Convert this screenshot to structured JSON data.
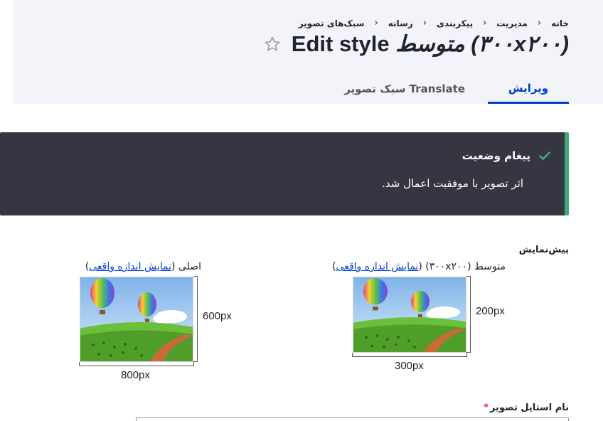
{
  "breadcrumb": {
    "items": [
      "خانه",
      "مدیریت",
      "پیکربندی",
      "رسانه",
      "سبک‌های تصویر"
    ]
  },
  "header": {
    "title_prefix": "Edit style ",
    "style_name": "متوسط (۳۰۰x۲۰۰)",
    "favorite_icon": "star-outline-icon"
  },
  "tabs": [
    {
      "label": "ویرایش",
      "active": true
    },
    {
      "label": "Translate سبک تصویر",
      "active": false
    }
  ],
  "status": {
    "heading": "پیغام وضعیت",
    "text": "اثر تصویر با موفقیت اعمال شد.",
    "icon": "check-icon",
    "accent_color": "#42a877"
  },
  "preview": {
    "label": "پیش‌نمایش",
    "derivative": {
      "caption_prefix": "متوسط (۳۰۰x۲۰۰) (",
      "link": "نمایش اندازه واقعی",
      "caption_suffix": ")",
      "width_label": "300px",
      "height_label": "200px"
    },
    "original": {
      "caption_prefix": "اصلی (",
      "link": "نمایش اندازه واقعی",
      "caption_suffix": ")",
      "width_label": "800px",
      "height_label": "600px"
    }
  },
  "form": {
    "name_label": "نام استایل تصویر",
    "required_mark": "*"
  },
  "colors": {
    "accent": "#003ecc",
    "message_bg": "#353641",
    "header_bg": "#f3f4f9"
  }
}
